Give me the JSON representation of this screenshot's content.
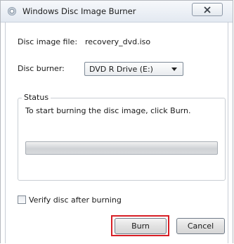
{
  "window": {
    "title": "Windows Disc Image Burner"
  },
  "fields": {
    "image_label": "Disc image file:",
    "image_value": "recovery_dvd.iso",
    "burner_label": "Disc burner:",
    "burner_value": "DVD R Drive (E:)"
  },
  "status": {
    "legend": "Status",
    "message": "To start burning the disc image, click Burn.",
    "progress": 0
  },
  "verify": {
    "label": "Verify disc after burning",
    "checked": false
  },
  "buttons": {
    "burn": "Burn",
    "cancel": "Cancel"
  },
  "colors": {
    "highlight": "#d71f26",
    "progress_fill": "#38b44a"
  },
  "icons": {
    "app": "disc-icon",
    "close": "close-icon",
    "dropdown": "chevron-down-icon"
  }
}
